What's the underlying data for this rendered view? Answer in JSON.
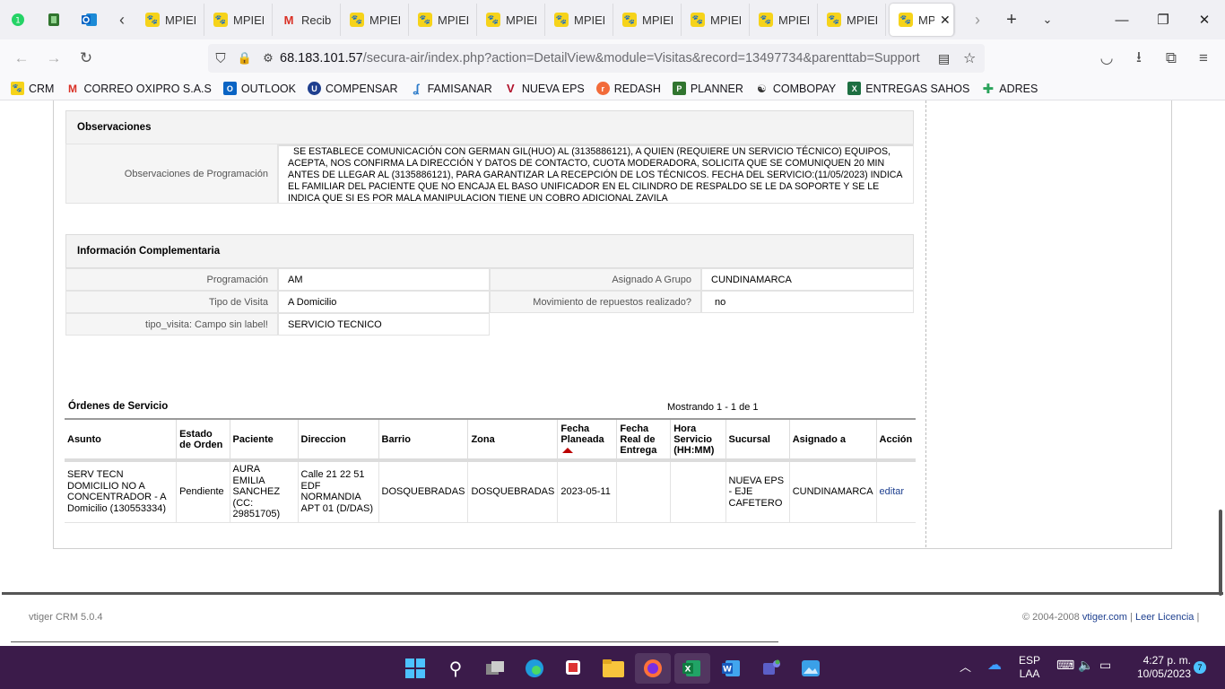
{
  "browser": {
    "tabs": [
      {
        "label": "MPIEDR",
        "active": false
      },
      {
        "label": "MPIEDR",
        "active": false
      },
      {
        "label": "Recibidos",
        "active": false
      },
      {
        "label": "MPIEDR",
        "active": false
      },
      {
        "label": "MPIEDR",
        "active": false
      },
      {
        "label": "MPIEDR",
        "active": false
      },
      {
        "label": "MPIEDR",
        "active": false
      },
      {
        "label": "MPIEDR",
        "active": false
      },
      {
        "label": "MPIEDR",
        "active": false
      },
      {
        "label": "MPIEDR",
        "active": false
      },
      {
        "label": "MPIEDR",
        "active": false
      },
      {
        "label": "MP",
        "active": true
      }
    ],
    "url_host": "68.183.101.57",
    "url_path": "/secura-air/index.php?action=DetailView&module=Visitas&record=13497734&parenttab=Support",
    "bookmarks": [
      {
        "label": "CRM",
        "color": "#f6d31a"
      },
      {
        "label": "CORREO OXIPRO S.A.S",
        "color": "#d93025"
      },
      {
        "label": "OUTLOOK",
        "color": "#0a64c4"
      },
      {
        "label": "COMPENSAR",
        "color": "#1f3f8f"
      },
      {
        "label": "FAMISANAR",
        "color": "#2b7ac9"
      },
      {
        "label": "NUEVA EPS",
        "color": "#b0102a"
      },
      {
        "label": "REDASH",
        "color": "#f26b3a"
      },
      {
        "label": "PLANNER",
        "color": "#31752f"
      },
      {
        "label": "COMBOPAY",
        "color": "#333333"
      },
      {
        "label": "ENTREGAS SAHOS",
        "color": "#1d6f42"
      },
      {
        "label": "ADRES",
        "color": "#2aa35b"
      }
    ]
  },
  "observaciones": {
    "title": "Observaciones",
    "label": "Observaciones de Programación",
    "text": "SE ESTABLECE COMUNICACIÓN CON GERMAN GIL(HUO) AL (3135886121), A QUIEN (REQUIERE UN SERVICIO TÉCNICO) EQUIPOS, ACEPTA, NOS CONFIRMA LA DIRECCIÓN Y DATOS DE CONTACTO, CUOTA MODERADORA, SOLICITA QUE SE COMUNIQUEN 20 MIN ANTES DE LLEGAR AL (3135886121), PARA GARANTIZAR LA RECEPCIÓN DE LOS TÉCNICOS. FECHA DEL SERVICIO:(11/05/2023) INDICA EL FAMILIAR DEL PACIENTE QUE NO ENCAJA EL BASO UNIFICADOR EN EL CILINDRO DE RESPALDO SE LE DA SOPORTE Y SE LE INDICA QUE SI ES POR MALA MANIPULACION TIENE UN COBRO ADICIONAL ZAVILA"
  },
  "info": {
    "title": "Información Complementaria",
    "programacion_label": "Programación",
    "programacion_value": "AM",
    "grupo_label": "Asignado A Grupo",
    "grupo_value": "CUNDINAMARCA",
    "tipo_label": "Tipo de Visita",
    "tipo_value": "A Domicilio",
    "repuestos_label": "Movimiento de repuestos realizado?",
    "repuestos_value": "no",
    "campo_label": "tipo_visita: Campo sin label!",
    "campo_value": "SERVICIO TECNICO"
  },
  "ordenes": {
    "title": "Órdenes de Servicio",
    "mostrando": "Mostrando 1 - 1 de 1",
    "headers": [
      "Asunto",
      "Estado de Orden",
      "Paciente",
      "Direccion",
      "Barrio",
      "Zona",
      "Fecha Planeada",
      "Fecha Real de Entrega",
      "Hora Servicio (HH:MM)",
      "Sucursal",
      "Asignado a",
      "Acción"
    ],
    "row": {
      "asunto": "SERV TECN DOMICILIO NO A CONCENTRADOR - A Domicilio (130553334)",
      "estado": "Pendiente",
      "paciente": "AURA EMILIA SANCHEZ (CC: 29851705)",
      "direccion": "Calle 21 22 51 EDF NORMANDIA APT 01 (D/DAS)",
      "barrio": "DOSQUEBRADAS",
      "zona": "DOSQUEBRADAS",
      "fecha_planeada": "2023-05-11",
      "fecha_real": "",
      "hora": "",
      "sucursal": "NUEVA EPS - EJE CAFETERO",
      "asignado": "CUNDINAMARCA",
      "accion": "editar"
    }
  },
  "footer": {
    "left": "vtiger CRM 5.0.4",
    "copyright": "© 2004-2008",
    "vtiger_link": "vtiger.com",
    "sep": "|",
    "licencia": "Leer Licencia",
    "sep2": "|"
  },
  "taskbar": {
    "lang": "ESP",
    "layout": "LAA",
    "time": "4:27 p. m.",
    "date": "10/05/2023",
    "notif": "7"
  }
}
